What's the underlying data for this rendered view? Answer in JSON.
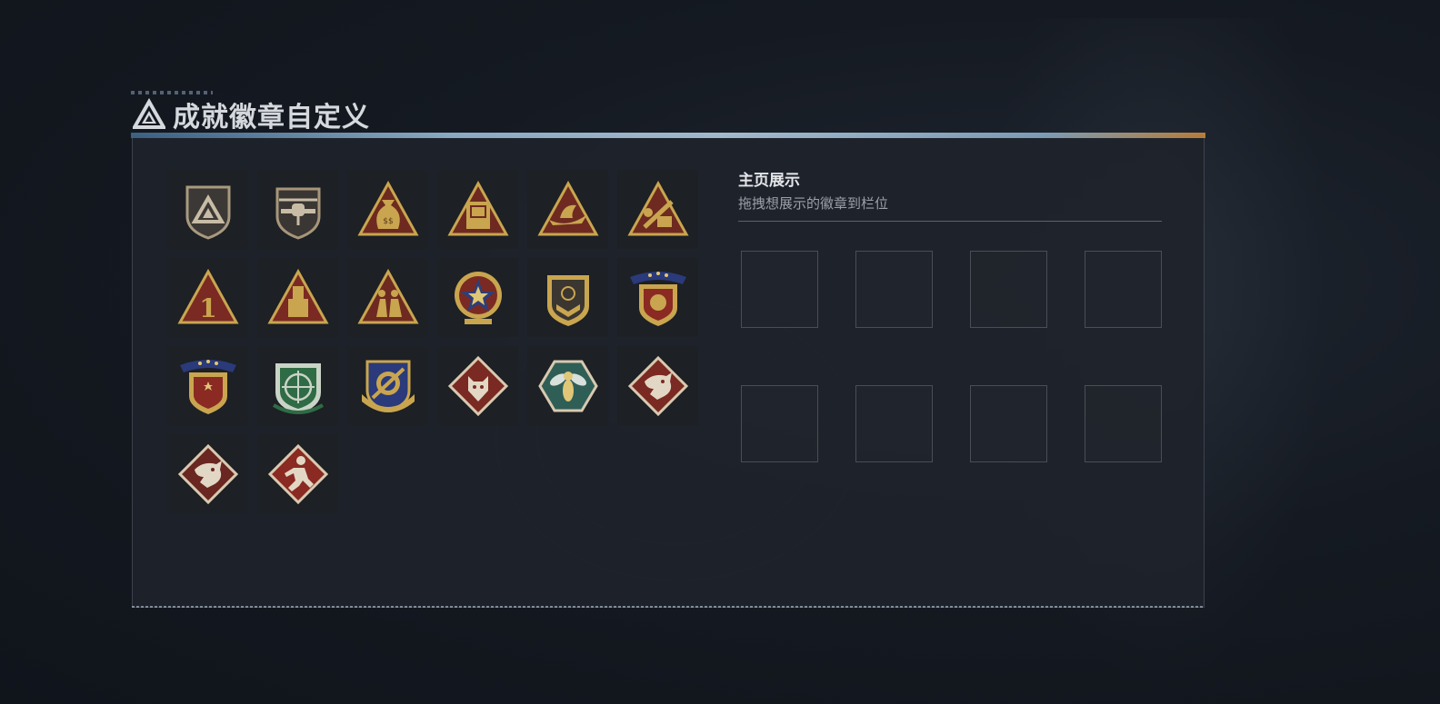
{
  "page_title": "成就徽章自定义",
  "title_icon": "triangle-logo-icon",
  "showcase": {
    "title": "主页展示",
    "subtitle": "拖拽想展示的徽章到栏位"
  },
  "badges": [
    {
      "icon": "shield-triangle-badge-icon"
    },
    {
      "icon": "helicopter-badge-icon"
    },
    {
      "icon": "money-bag-badge-icon"
    },
    {
      "icon": "safe-box-badge-icon"
    },
    {
      "icon": "boat-badge-icon"
    },
    {
      "icon": "construction-badge-icon"
    },
    {
      "icon": "number-one-badge-icon"
    },
    {
      "icon": "tower-badge-icon"
    },
    {
      "icon": "soldiers-badge-icon"
    },
    {
      "icon": "star-medal-badge-icon"
    },
    {
      "icon": "chevron-shield-badge-icon"
    },
    {
      "icon": "ribbon-shield-badge-icon"
    },
    {
      "icon": "ribbon-star-shield-badge-icon"
    },
    {
      "icon": "crosshair-rifle-badge-icon"
    },
    {
      "icon": "wreath-crosshair-badge-icon"
    },
    {
      "icon": "wolf-diamond-badge-icon"
    },
    {
      "icon": "hornet-hexagon-badge-icon"
    },
    {
      "icon": "dragon-diamond-badge-icon"
    },
    {
      "icon": "dragon-diamond-badge-icon-2"
    },
    {
      "icon": "runner-diamond-badge-icon"
    }
  ],
  "slots_count": 8,
  "colors": {
    "gold": "#c9a54f",
    "dark_red": "#7a2a22",
    "green": "#2f6b45",
    "navy": "#2a3a7a"
  }
}
